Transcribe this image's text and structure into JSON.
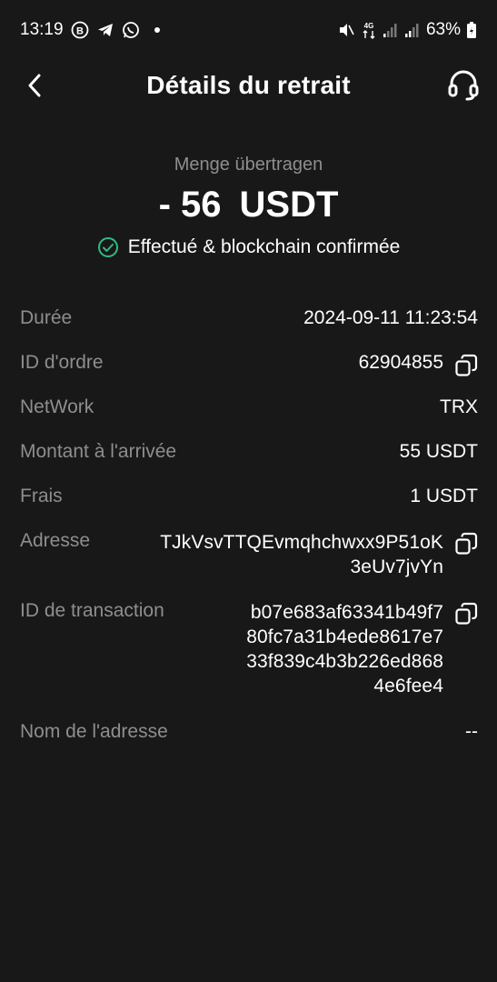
{
  "status_bar": {
    "time": "13:19",
    "battery": "63%",
    "network": "4G"
  },
  "header": {
    "title": "Détails du retrait"
  },
  "summary": {
    "amount_label": "Menge übertragen",
    "amount": "- 56",
    "currency": "USDT",
    "status": "Effectué & blockchain confirmée"
  },
  "details": {
    "duration_label": "Durée",
    "duration_value": "2024-09-11 11:23:54",
    "order_id_label": "ID d'ordre",
    "order_id_value": "62904855",
    "network_label": "NetWork",
    "network_value": "TRX",
    "arrival_label": "Montant à l'arrivée",
    "arrival_value": "55 USDT",
    "fees_label": "Frais",
    "fees_value": "1 USDT",
    "address_label": "Adresse",
    "address_lines": [
      "TJkVsvTTQEvmqhchwxx9P51oK",
      "3eUv7jvYn"
    ],
    "tx_label": "ID de transaction",
    "tx_lines": [
      "b07e683af63341b49f7",
      "80fc7a31b4ede8617e7",
      "33f839c4b3b226ed868",
      "4e6fee4"
    ],
    "address_name_label": "Nom de l'adresse",
    "address_name_value": "--"
  },
  "colors": {
    "background": "#181818",
    "muted_text": "#8e8e8e",
    "success": "#2fbd85"
  },
  "icons": [
    "back-chevron-icon",
    "headset-icon",
    "check-circle-icon",
    "copy-icon"
  ]
}
